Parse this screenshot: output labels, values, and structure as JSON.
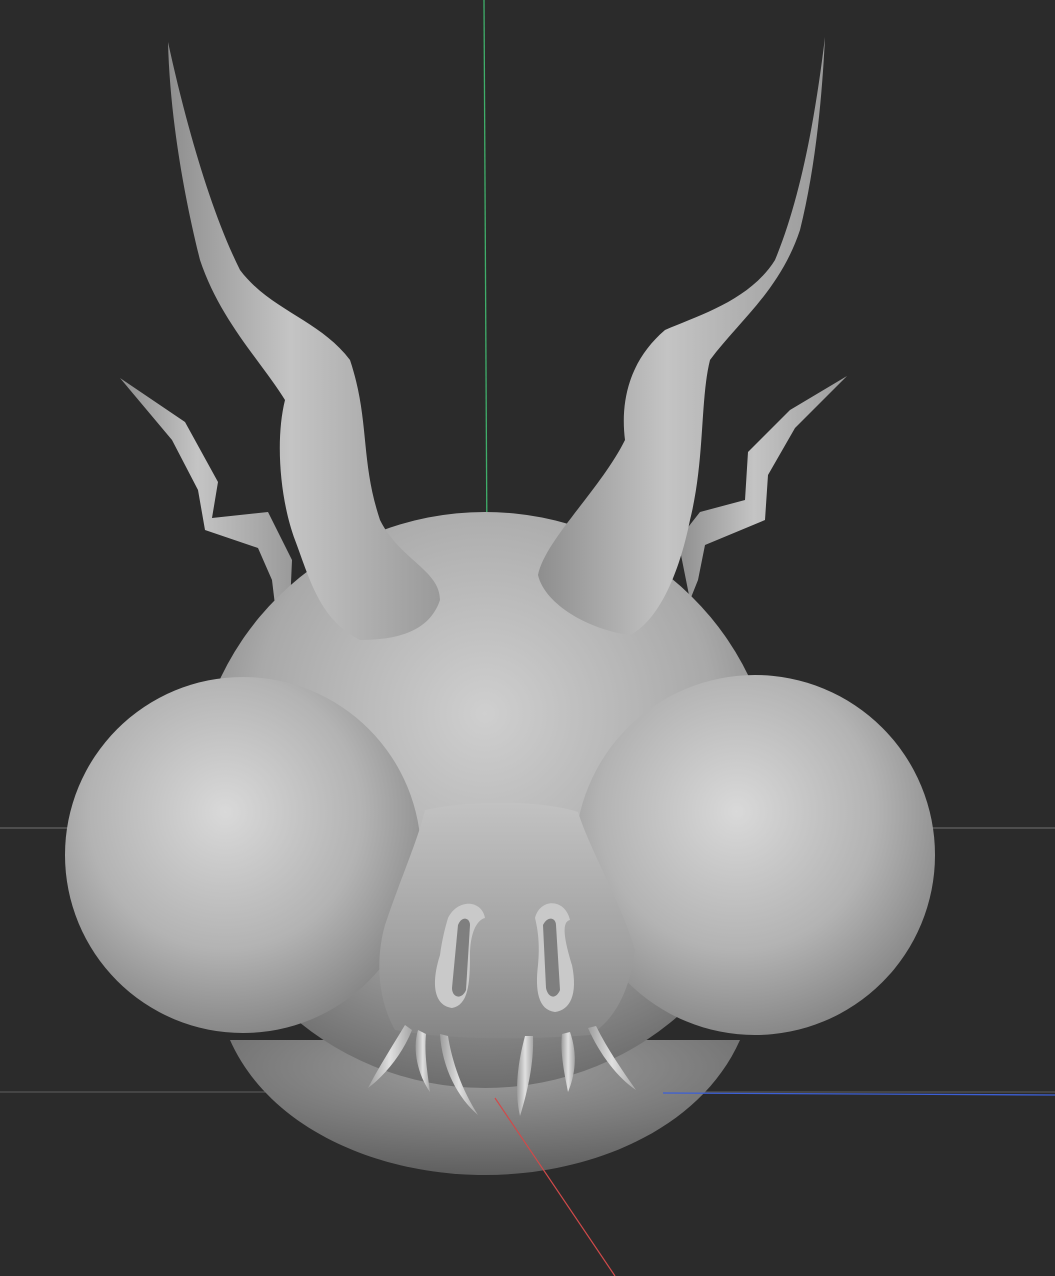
{
  "viewport": {
    "background": "#2b2b2b",
    "grid_line_color": "#5a5a5a",
    "axis_colors": {
      "x": "#d04a4a",
      "y": "#3fae6a",
      "z": "#3c5fd6"
    }
  },
  "model": {
    "material_color": "#b4b4b4",
    "parts": [
      "head",
      "left-eye-sphere",
      "right-eye-sphere",
      "snout",
      "nostrils",
      "teeth",
      "horns",
      "antlers"
    ]
  }
}
